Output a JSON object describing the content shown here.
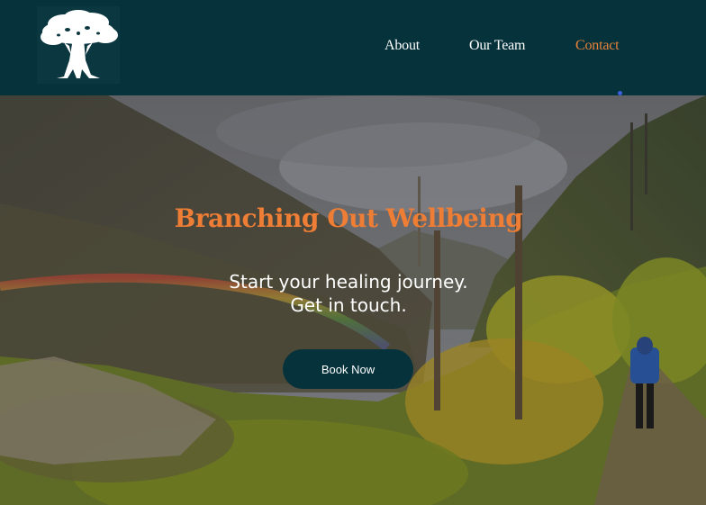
{
  "header": {
    "logo_icon": "tree-icon",
    "nav": {
      "about": "About",
      "our_team": "Our Team",
      "contact": "Contact"
    },
    "active_item": "contact"
  },
  "hero": {
    "title": "Branching Out Wellbeing",
    "subtitle_line1": "Start your healing journey.",
    "subtitle_line2": "Get in touch.",
    "cta_label": "Book Now",
    "background": "mountain-valley-hiker-rainbow-photo"
  },
  "colors": {
    "header_bg": "#06323b",
    "accent": "#ee7d35",
    "button_bg": "#06323b",
    "text": "#ffffff"
  }
}
